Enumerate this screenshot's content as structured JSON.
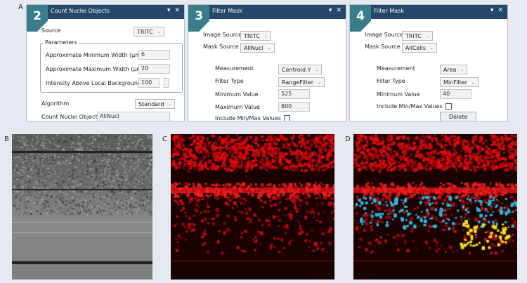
{
  "figure_labels": {
    "a": "A",
    "b": "B",
    "c": "C",
    "d": "D"
  },
  "icons": {
    "pin": "pin-icon",
    "close": "close-icon",
    "chevron": "chevron-down-icon"
  },
  "colors": {
    "header": "#25486a",
    "badge": "#3a7d8a",
    "nuclei": "#e0141a",
    "cyan": "#2fb8e0",
    "yellow": "#f2e21a"
  },
  "panel2": {
    "step": "2",
    "title": "Count Nuclei Objects",
    "source_label": "Source",
    "source_value": "TRITC",
    "parameters_legend": "Parameters",
    "min_width_label": "Approximate Minimum Width (µm)",
    "min_width_value": "6",
    "max_width_label": "Approximate Maximum Width (µm)",
    "max_width_value": "20",
    "intensity_label": "Intensity Above Local Background",
    "intensity_value": "100",
    "algorithm_label": "Algorithm",
    "algorithm_value": "Standard",
    "output_label": "Count Nuclei Objects",
    "output_value": "AllNucl"
  },
  "panel3": {
    "step": "3",
    "title": "Filter Mask",
    "image_source_label": "Image Source",
    "image_source_value": "TRITC",
    "mask_source_label": "Mask Source",
    "mask_source_value": "AllNucl",
    "measurement_label": "Measurement",
    "measurement_value": "Centroid Y",
    "filter_type_label": "Filter Type",
    "filter_type_value": "RangeFilter",
    "min_value_label": "Minimum Value",
    "min_value": "525",
    "max_value_label": "Maximum Value",
    "max_value": "800",
    "include_label": "Include Min/Max Values"
  },
  "panel4": {
    "step": "4",
    "title": "Filter Mask",
    "image_source_label": "Image Source",
    "image_source_value": "TRITC",
    "mask_source_label": "Mask Source",
    "mask_source_value": "AllCells",
    "measurement_label": "Measurement",
    "measurement_value": "Area",
    "filter_type_label": "Filter Type",
    "filter_type_value": "MinFilter",
    "min_value_label": "Minimum Value",
    "min_value": "40",
    "include_label": "Include Min/Max Values",
    "delete_label": "Delete"
  }
}
